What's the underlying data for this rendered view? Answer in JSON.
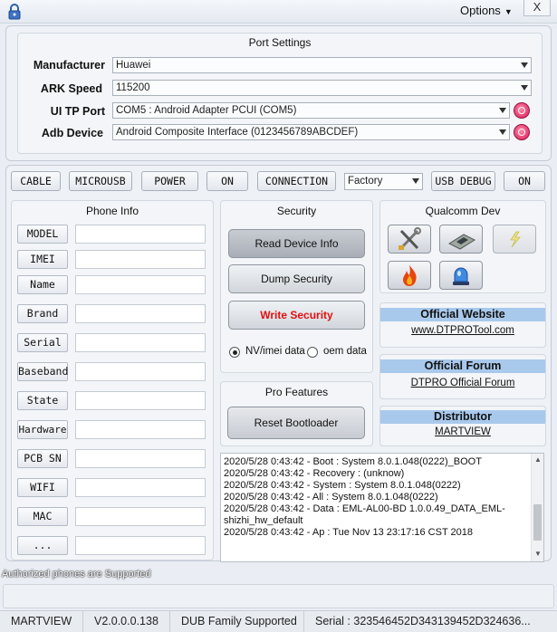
{
  "titlebar": {
    "options": "Options",
    "close": "X"
  },
  "port_settings": {
    "title": "Port Settings",
    "manufacturer": {
      "label": "Manufacturer",
      "value": "Huawei"
    },
    "ark_speed": {
      "label": "ARK Speed",
      "value": "115200"
    },
    "ui_tp_port": {
      "label": "UI TP Port",
      "value": "COM5 : Android Adapter PCUI (COM5)"
    },
    "adb_device": {
      "label": "Adb Device",
      "value": "Android Composite Interface (0123456789ABCDEF)"
    }
  },
  "toolbar": {
    "cable": "CABLE",
    "microusb": "MICROUSB",
    "power": "POWER",
    "on1": "ON",
    "connection": "CONNECTION",
    "mode_select": "Factory",
    "usb_debug": "USB DEBUG",
    "on2": "ON"
  },
  "phone_info": {
    "title": "Phone Info",
    "items": [
      "MODEL",
      "IMEI",
      "Name",
      "Brand",
      "Serial",
      "Baseband",
      "State",
      "Hardware",
      "PCB SN",
      "WIFI",
      "MAC",
      "..."
    ]
  },
  "security": {
    "title": "Security",
    "read_info": "Read Device Info",
    "dump": "Dump Security",
    "write": "Write Security",
    "radio_nv": "NV/imei data",
    "radio_oem": "oem data"
  },
  "pro_features": {
    "title": "Pro Features",
    "reset_bootloader": "Reset Bootloader"
  },
  "qualcomm": {
    "title": "Qualcomm Dev",
    "icons": [
      "tools-icon",
      "chip-icon",
      "lightning-icon",
      "fire-icon",
      "siren-icon"
    ]
  },
  "links": {
    "website_title": "Official Website",
    "website_link": "www.DTPROTool.com",
    "forum_title": "Official Forum",
    "forum_link": "DTPRO Official Forum",
    "distributor_title": "Distributor",
    "distributor_link": "MARTVIEW"
  },
  "log": {
    "lines": [
      "2020/5/28 0:43:42 - Boot : System 8.0.1.048(0222)_BOOT",
      "2020/5/28 0:43:42 - Recovery : (unknow)",
      "2020/5/28 0:43:42 - System : System 8.0.1.048(0222)",
      "2020/5/28 0:43:42 - All : System 8.0.1.048(0222)",
      "2020/5/28 0:43:42 - Data : EML-AL00-BD 1.0.0.49_DATA_EML-",
      "shizhi_hw_default",
      "2020/5/28 0:43:42 - Ap : Tue Nov 13 23:17:16 CST 2018"
    ]
  },
  "footer": {
    "authorized": "Authorized phones are Supported"
  },
  "statusbar": {
    "brand": "MARTVIEW",
    "version": "V2.0.0.0.138",
    "family": "DUB Family Supported",
    "serial": "Serial : 323546452D343139452D324636..."
  },
  "colors": {
    "write_security": "#e01010",
    "link_header": "#a9c9ec",
    "pink_button": "#d8175a"
  }
}
